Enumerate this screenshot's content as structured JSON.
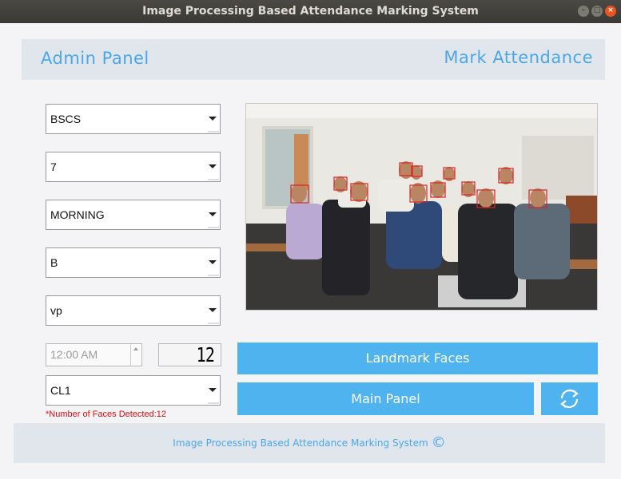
{
  "window": {
    "title": "Image Processing Based Attendance Marking System"
  },
  "header": {
    "left_label": "Admin Panel",
    "right_label": "Mark Attendance"
  },
  "form": {
    "program": "BSCS",
    "semester": "7",
    "shift": "MORNING",
    "section": "B",
    "teacher": "vp",
    "time": "12:00 AM",
    "face_count_display": "12",
    "class_room": "CL1",
    "faces_detected_note": "*Number of Faces Detected:12"
  },
  "buttons": {
    "landmark": "Landmark Faces",
    "main_panel": "Main Panel",
    "refresh_icon": "refresh-icon"
  },
  "footer": {
    "text": "Image Processing Based Attendance Marking System",
    "copyright_symbol": "©"
  },
  "colors": {
    "accent": "#4fb3f0",
    "header_text": "#4aa8e8",
    "note_text": "#e01010",
    "face_box": "#e02020"
  }
}
